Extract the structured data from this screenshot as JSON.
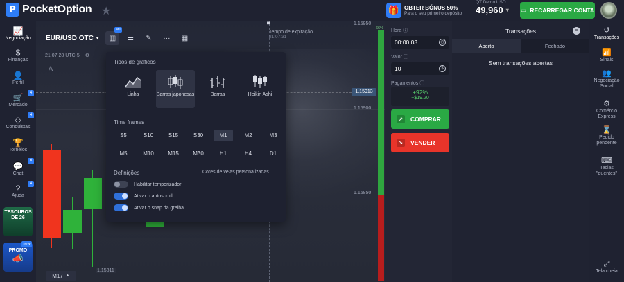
{
  "header": {
    "logo_text": "PocketOption",
    "bonus_title": "OBTER BÓNUS 50%",
    "bonus_subtitle": "Para o seu primeiro depósito",
    "account_label": "QT Demo  USD",
    "balance": "49,960",
    "recharge_label": "RECARREGAR CONTA"
  },
  "left_sidebar": {
    "items": [
      {
        "label": "Negociação",
        "icon": "chart-icon"
      },
      {
        "label": "Finanças",
        "icon": "dollar-icon"
      },
      {
        "label": "Perfil",
        "icon": "user-icon"
      },
      {
        "label": "Mercado",
        "icon": "cart-icon",
        "badge": "4"
      },
      {
        "label": "Conquistas",
        "icon": "diamond-icon",
        "badge": "4"
      },
      {
        "label": "Torneios",
        "icon": "trophy-icon"
      },
      {
        "label": "Chat",
        "icon": "chat-icon",
        "badge": "6"
      },
      {
        "label": "Ajuda",
        "icon": "help-icon",
        "badge": "4"
      }
    ],
    "promo_tile_1": "TESOUROS DE 26",
    "promo_tile_2": "PROMO",
    "promo_tile_2_badge": "new"
  },
  "chart": {
    "asset": "EUR/USD OTC",
    "chart_type_badge": "M1",
    "clock": "21:07:28 UTC-5",
    "drawing_label": "A",
    "expiry_label": "Tempo de expiração",
    "expiry_time": "21:07:31",
    "prices": {
      "p1": "1.15950",
      "current": "1.15913",
      "p2": "1.15900",
      "p3": "1.15850",
      "low": "1.15811"
    },
    "timeframe": "M17",
    "sentiment_pct": "66%",
    "up_color": "#2fb23a",
    "down_color": "#f0341e"
  },
  "popup": {
    "chart_types_title": "Tipos de gráficos",
    "chart_types": [
      {
        "label": "Linha",
        "icon": "line-chart-icon"
      },
      {
        "label": "Barras japonesas",
        "icon": "candles-icon",
        "selected": true
      },
      {
        "label": "Barras",
        "icon": "bars-icon"
      },
      {
        "label": "Heikin Ashi",
        "icon": "heikin-ashi-icon"
      }
    ],
    "timeframes_title": "Time frames",
    "timeframes": [
      "S5",
      "S10",
      "S15",
      "S30",
      "M1",
      "M2",
      "M3",
      "M5",
      "M10",
      "M15",
      "M30",
      "H1",
      "H4",
      "D1"
    ],
    "selected_timeframe": "M1",
    "settings_title": "Definições",
    "custom_colors_link": "Cores de velas personalizadas",
    "toggles": [
      {
        "label": "Habilitar temporizador",
        "on": false
      },
      {
        "label": "Ativar o autoscroll",
        "on": true
      },
      {
        "label": "Ativar o snap da grelha",
        "on": true
      }
    ]
  },
  "trade": {
    "time_label": "Hora",
    "time_value": "00:00:03",
    "amount_label": "Valor",
    "amount_value": "10",
    "payout_label": "Pagamentos",
    "payout_pct": "+92%",
    "payout_amount": "+$19.20",
    "buy_label": "COMPRAR",
    "sell_label": "VENDER",
    "buy_color": "#2aa944",
    "sell_color": "#e8342a"
  },
  "transactions": {
    "title": "Transações",
    "tab_open": "Aberto",
    "tab_closed": "Fechado",
    "empty_text": "Sem transações abertas"
  },
  "right_sidebar": {
    "items": [
      {
        "label": "Transações",
        "icon": "history-icon"
      },
      {
        "label": "Sinais",
        "icon": "signal-icon"
      },
      {
        "label": "Negociação Social",
        "icon": "group-icon"
      },
      {
        "label": "Comércio Express",
        "icon": "express-icon"
      },
      {
        "label": "Pedido pendente",
        "icon": "hourglass-icon"
      },
      {
        "label": "Teclas \"quentes\"",
        "icon": "keyboard-icon"
      }
    ],
    "fullscreen_label": "Tela cheia"
  }
}
